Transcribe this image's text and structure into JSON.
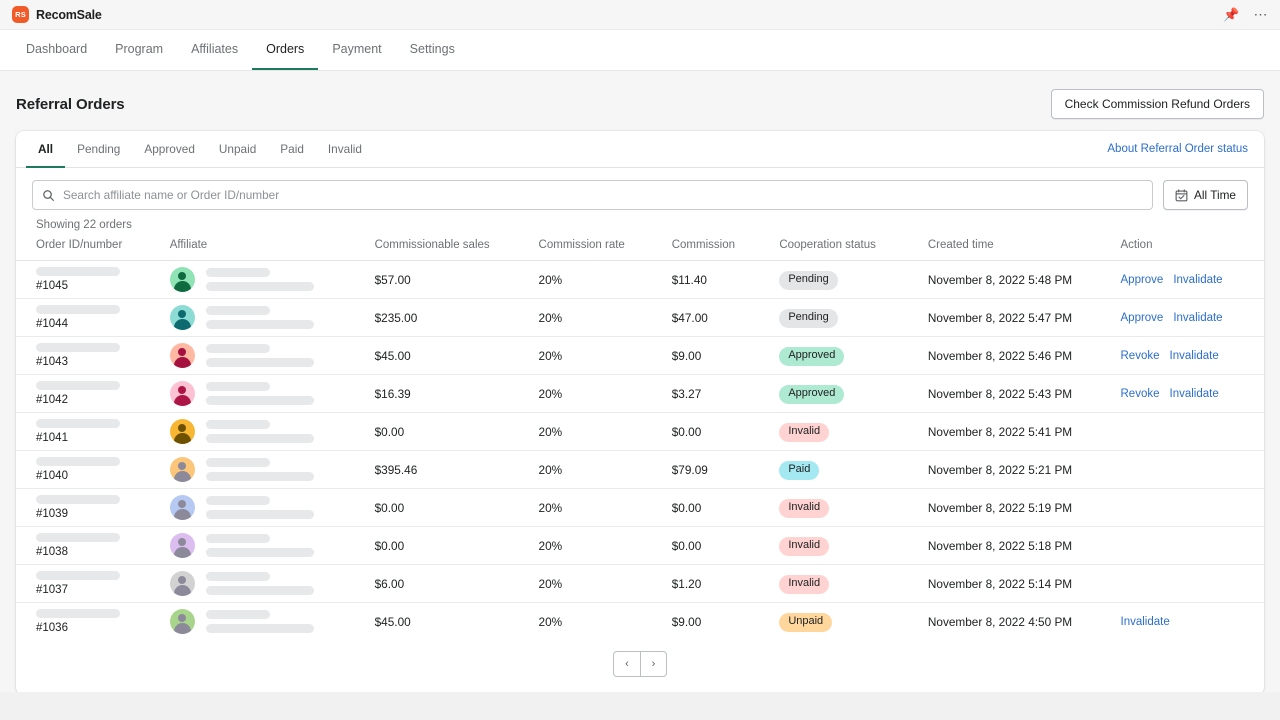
{
  "topbar": {
    "logo_mark": "RS",
    "logo_text": "RecomSale",
    "pin_icon": "pin-icon",
    "more_icon": "more-options-icon"
  },
  "nav": {
    "items": [
      {
        "label": "Dashboard",
        "active": false
      },
      {
        "label": "Program",
        "active": false
      },
      {
        "label": "Affiliates",
        "active": false
      },
      {
        "label": "Orders",
        "active": true
      },
      {
        "label": "Payment",
        "active": false
      },
      {
        "label": "Settings",
        "active": false
      }
    ]
  },
  "page": {
    "title": "Referral Orders",
    "refund_button": "Check Commission Refund Orders"
  },
  "tabs": [
    {
      "label": "All",
      "active": true
    },
    {
      "label": "Pending",
      "active": false
    },
    {
      "label": "Approved",
      "active": false
    },
    {
      "label": "Unpaid",
      "active": false
    },
    {
      "label": "Paid",
      "active": false
    },
    {
      "label": "Invalid",
      "active": false
    }
  ],
  "about_link": "About Referral Order status",
  "search": {
    "placeholder": "Search affiliate name or Order ID/number",
    "value": "",
    "icon": "search-icon"
  },
  "date_filter": {
    "label": "All Time",
    "icon": "calendar-icon"
  },
  "showing": "Showing 22 orders",
  "table": {
    "columns": [
      "Order ID/number",
      "Affiliate",
      "Commissionable sales",
      "Commission rate",
      "Commission",
      "Cooperation status",
      "Created time",
      "Action"
    ],
    "rows": [
      {
        "order_id": "#1045",
        "avatar_bg": "#8fe3b4",
        "avatar_fg": "#0f6b3f",
        "sales": "$57.00",
        "rate": "20%",
        "commission": "$11.40",
        "status": "Pending",
        "status_class": "badge-pending",
        "created": "November 8, 2022 5:48 PM",
        "actions": [
          "Approve",
          "Invalidate"
        ]
      },
      {
        "order_id": "#1044",
        "avatar_bg": "#8ddbd5",
        "avatar_fg": "#0d6b70",
        "sales": "$235.00",
        "rate": "20%",
        "commission": "$47.00",
        "status": "Pending",
        "status_class": "badge-pending",
        "created": "November 8, 2022 5:47 PM",
        "actions": [
          "Approve",
          "Invalidate"
        ]
      },
      {
        "order_id": "#1043",
        "avatar_bg": "#ffb9a3",
        "avatar_fg": "#a51240",
        "sales": "$45.00",
        "rate": "20%",
        "commission": "$9.00",
        "status": "Approved",
        "status_class": "badge-approved",
        "created": "November 8, 2022 5:46 PM",
        "actions": [
          "Revoke",
          "Invalidate"
        ]
      },
      {
        "order_id": "#1042",
        "avatar_bg": "#fcc2d4",
        "avatar_fg": "#ac1545",
        "sales": "$16.39",
        "rate": "20%",
        "commission": "$3.27",
        "status": "Approved",
        "status_class": "badge-approved",
        "created": "November 8, 2022 5:43 PM",
        "actions": [
          "Revoke",
          "Invalidate"
        ]
      },
      {
        "order_id": "#1041",
        "avatar_bg": "#f7b733",
        "avatar_fg": "#6e5100",
        "sales": "$0.00",
        "rate": "20%",
        "commission": "$0.00",
        "status": "Invalid",
        "status_class": "badge-invalid",
        "created": "November 8, 2022 5:41 PM",
        "actions": []
      },
      {
        "order_id": "#1040",
        "avatar_bg": "#fbc67a",
        "avatar_fg": "#8c8a9a",
        "sales": "$395.46",
        "rate": "20%",
        "commission": "$79.09",
        "status": "Paid",
        "status_class": "badge-paid",
        "created": "November 8, 2022 5:21 PM",
        "actions": []
      },
      {
        "order_id": "#1039",
        "avatar_bg": "#b5c9f2",
        "avatar_fg": "#8c8a9a",
        "sales": "$0.00",
        "rate": "20%",
        "commission": "$0.00",
        "status": "Invalid",
        "status_class": "badge-invalid",
        "created": "November 8, 2022 5:19 PM",
        "actions": []
      },
      {
        "order_id": "#1038",
        "avatar_bg": "#dcbdf0",
        "avatar_fg": "#8c8a9a",
        "sales": "$0.00",
        "rate": "20%",
        "commission": "$0.00",
        "status": "Invalid",
        "status_class": "badge-invalid",
        "created": "November 8, 2022 5:18 PM",
        "actions": []
      },
      {
        "order_id": "#1037",
        "avatar_bg": "#d2d2d2",
        "avatar_fg": "#8c8a9a",
        "sales": "$6.00",
        "rate": "20%",
        "commission": "$1.20",
        "status": "Invalid",
        "status_class": "badge-invalid",
        "created": "November 8, 2022 5:14 PM",
        "actions": []
      },
      {
        "order_id": "#1036",
        "avatar_bg": "#a9d48b",
        "avatar_fg": "#8c8a9a",
        "sales": "$45.00",
        "rate": "20%",
        "commission": "$9.00",
        "status": "Unpaid",
        "status_class": "badge-unpaid",
        "created": "November 8, 2022 4:50 PM",
        "actions": [
          "Invalidate"
        ]
      }
    ]
  },
  "pagination": {
    "prev": "‹",
    "next": "›"
  }
}
